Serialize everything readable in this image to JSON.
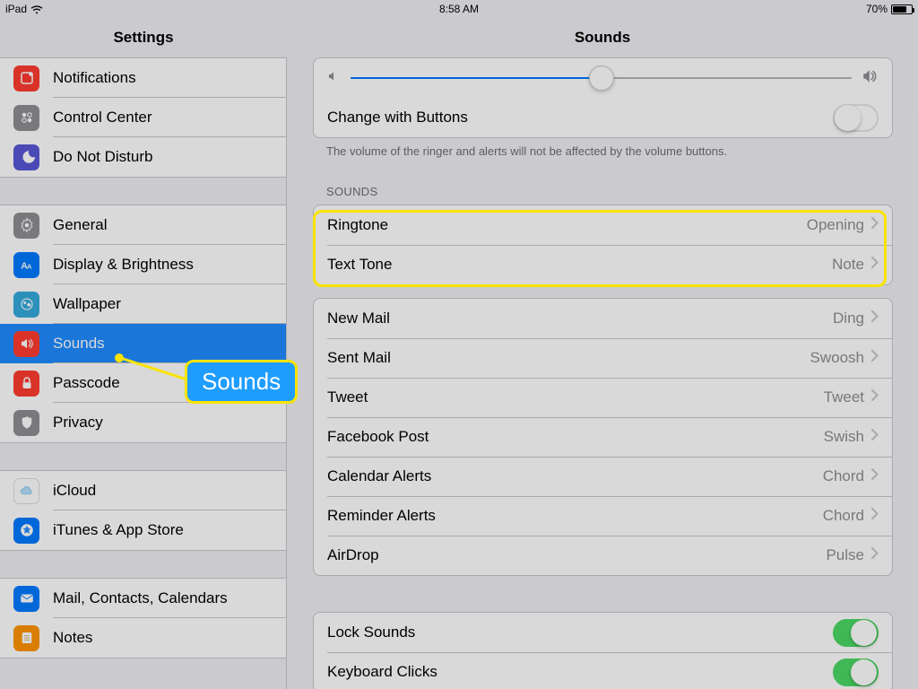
{
  "status": {
    "device": "iPad",
    "time": "8:58 AM",
    "battery_pct": "70%",
    "battery_fill_pct": 70
  },
  "headers": {
    "left": "Settings",
    "right": "Sounds"
  },
  "sidebar": {
    "groups": [
      {
        "items": [
          {
            "label": "Notifications",
            "icon": "notifications-icon",
            "bg": "bg-red"
          },
          {
            "label": "Control Center",
            "icon": "control-center-icon",
            "bg": "bg-grey"
          },
          {
            "label": "Do Not Disturb",
            "icon": "dnd-icon",
            "bg": "bg-purple"
          }
        ]
      },
      {
        "items": [
          {
            "label": "General",
            "icon": "gear-icon",
            "bg": "bg-grey"
          },
          {
            "label": "Display & Brightness",
            "icon": "display-icon",
            "bg": "bg-blue"
          },
          {
            "label": "Wallpaper",
            "icon": "wallpaper-icon",
            "bg": "bg-cyan"
          },
          {
            "label": "Sounds",
            "selected": true,
            "icon": "sounds-icon",
            "bg": "bg-red"
          },
          {
            "label": "Passcode",
            "icon": "passcode-icon",
            "bg": "bg-red"
          },
          {
            "label": "Privacy",
            "icon": "privacy-icon",
            "bg": "bg-grey"
          }
        ]
      },
      {
        "items": [
          {
            "label": "iCloud",
            "icon": "icloud-icon",
            "bg": "bg-white"
          },
          {
            "label": "iTunes & App Store",
            "icon": "appstore-icon",
            "bg": "bg-blue"
          }
        ]
      },
      {
        "items": [
          {
            "label": "Mail, Contacts, Calendars",
            "icon": "mail-icon",
            "bg": "bg-blue"
          },
          {
            "label": "Notes",
            "icon": "notes-icon",
            "bg": "bg-orange"
          }
        ]
      }
    ]
  },
  "sounds_panel": {
    "volume_pct": 50,
    "change_label": "Change with Buttons",
    "change_on": false,
    "caption": "The volume of the ringer and alerts will not be affected by the volume buttons.",
    "section_label": "SOUNDS",
    "items": [
      {
        "label": "Ringtone",
        "value": "Opening",
        "section": 0
      },
      {
        "label": "Text Tone",
        "value": "Note",
        "section": 0
      },
      {
        "label": "New Mail",
        "value": "Ding",
        "section": 1
      },
      {
        "label": "Sent Mail",
        "value": "Swoosh",
        "section": 1
      },
      {
        "label": "Tweet",
        "value": "Tweet",
        "section": 1
      },
      {
        "label": "Facebook Post",
        "value": "Swish",
        "section": 1
      },
      {
        "label": "Calendar Alerts",
        "value": "Chord",
        "section": 1
      },
      {
        "label": "Reminder Alerts",
        "value": "Chord",
        "section": 1
      },
      {
        "label": "AirDrop",
        "value": "Pulse",
        "section": 1
      }
    ],
    "toggles": [
      {
        "label": "Lock Sounds",
        "on": true
      },
      {
        "label": "Keyboard Clicks",
        "on": true
      }
    ]
  },
  "annotation": {
    "callout_label": "Sounds",
    "highlight_colors": {
      "border": "#f9e400",
      "fill": "#1f9dff"
    }
  }
}
